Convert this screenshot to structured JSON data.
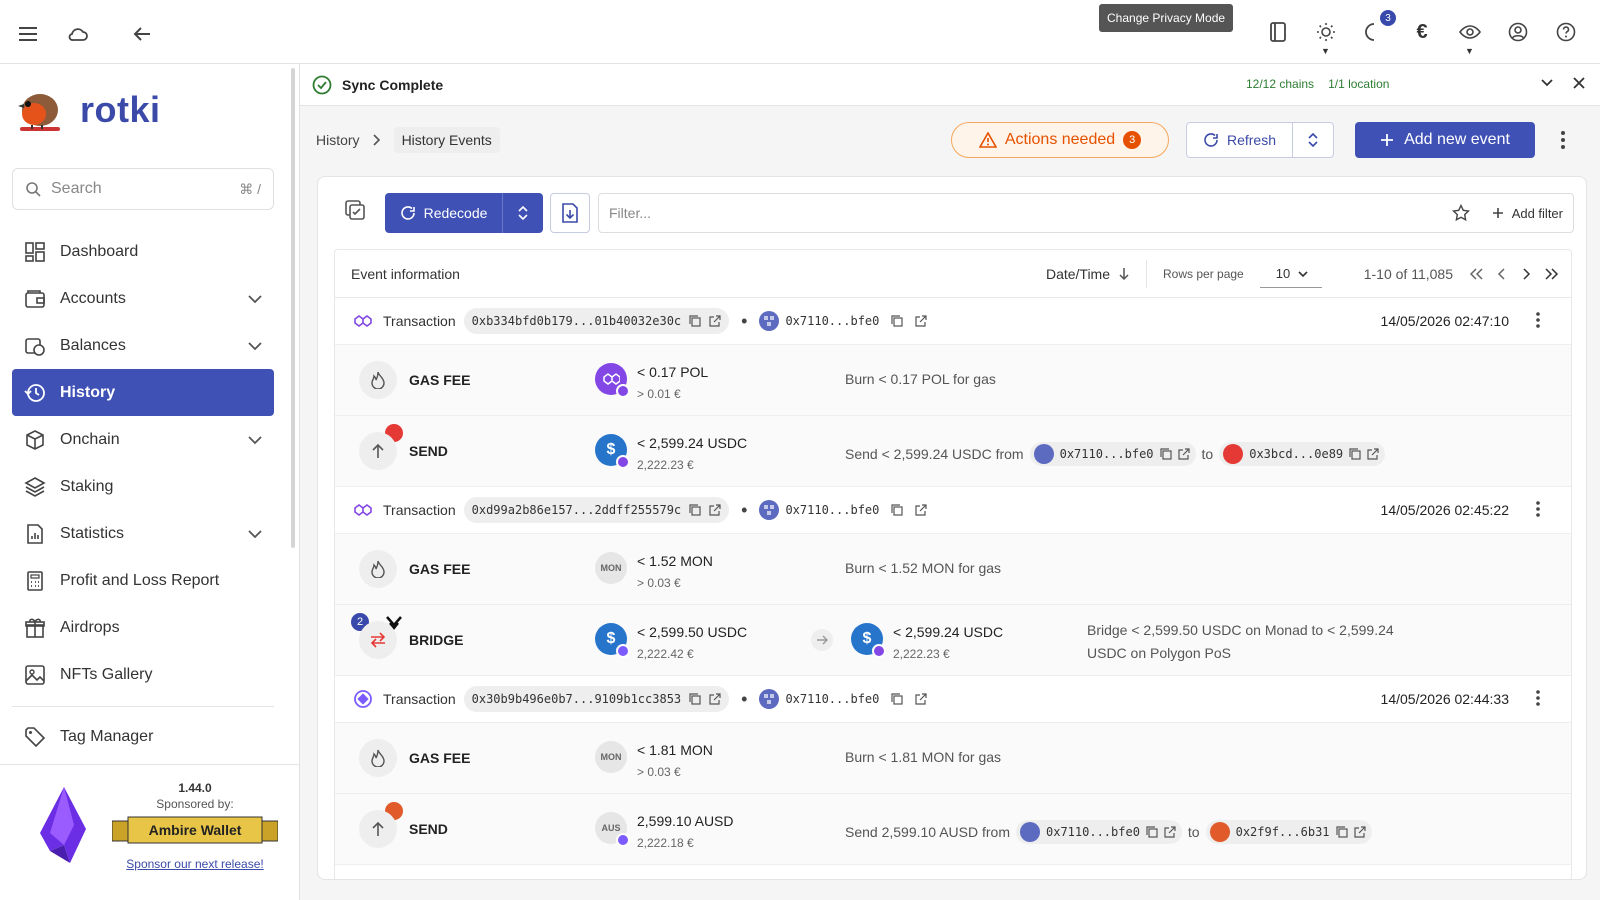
{
  "topbar": {
    "notification_count": "3",
    "currency_symbol": "€"
  },
  "sidebar": {
    "logo_text": "rotki",
    "search_placeholder": "Search",
    "search_shortcut": "⌘ /",
    "items": [
      {
        "label": "Dashboard",
        "icon": "dashboard-icon",
        "expandable": false,
        "active": false
      },
      {
        "label": "Accounts",
        "icon": "wallet-icon",
        "expandable": true,
        "active": false
      },
      {
        "label": "Balances",
        "icon": "balances-icon",
        "expandable": true,
        "active": false
      },
      {
        "label": "History",
        "icon": "history-icon",
        "expandable": false,
        "active": true
      },
      {
        "label": "Onchain",
        "icon": "cube-icon",
        "expandable": true,
        "active": false
      },
      {
        "label": "Staking",
        "icon": "layers-icon",
        "expandable": false,
        "active": false
      },
      {
        "label": "Statistics",
        "icon": "chart-file-icon",
        "expandable": true,
        "active": false
      },
      {
        "label": "Profit and Loss Report",
        "icon": "calculator-icon",
        "expandable": false,
        "active": false
      },
      {
        "label": "Airdrops",
        "icon": "gift-icon",
        "expandable": false,
        "active": false
      },
      {
        "label": "NFTs Gallery",
        "icon": "image-icon",
        "expandable": false,
        "active": false
      }
    ],
    "tag_manager": "Tag Manager",
    "sponsor": {
      "version": "1.44.0",
      "sponsored_by": "Sponsored by:",
      "sponsor_name": "Ambire Wallet",
      "link": "Sponsor our next release!"
    }
  },
  "sync": {
    "status": "Sync Complete",
    "chains": "12/12 chains",
    "location": "1/1 location",
    "tooltip": "Change Privacy Mode"
  },
  "header": {
    "breadcrumb_root": "History",
    "breadcrumb_current": "History Events",
    "actions_label": "Actions needed",
    "actions_count": "3",
    "refresh_label": "Refresh",
    "add_label": "Add new event"
  },
  "toolbar": {
    "redecode_label": "Redecode",
    "filter_placeholder": "Filter...",
    "add_filter": "Add filter"
  },
  "table": {
    "col_event": "Event information",
    "col_sort": "Date/Time",
    "rows_per_page_label": "Rows per page",
    "rows_per_page": "10",
    "range": "1-10 of 11,085",
    "groups": [
      {
        "label": "Transaction",
        "hash": "0xb334bfd0b179...01b40032e30c",
        "address": "0x7110...bfe0",
        "time": "14/05/2026 02:47:10",
        "events": [
          {
            "type": "GAS FEE",
            "icon": "flame-icon",
            "asset": "POL",
            "asset_color": "#8247e5",
            "amount": "< 0.17 POL",
            "value": "> 0.01 €",
            "desc": "Burn < 0.17 POL for gas"
          },
          {
            "type": "SEND",
            "icon": "arrow-up-icon",
            "asset": "USDC",
            "asset_color": "#2775ca",
            "amount": "< 2,599.24 USDC",
            "value": "2,222.23 €",
            "desc": "Send < 2,599.24 USDC from",
            "from": "0x7110...bfe0",
            "to_word": "to",
            "to": "0x3bcd...0e89"
          }
        ]
      },
      {
        "label": "Transaction",
        "hash": "0xd99a2b86e157...2ddff255579c",
        "address": "0x7110...bfe0",
        "time": "14/05/2026 02:45:22",
        "events": [
          {
            "type": "GAS FEE",
            "icon": "flame-icon",
            "asset": "MON",
            "asset_color": "#e0e0e0",
            "amount": "< 1.52 MON",
            "value": "> 0.03 €",
            "desc": "Burn < 1.52 MON for gas"
          },
          {
            "type": "BRIDGE",
            "icon": "swap-icon",
            "badge": "2",
            "asset": "USDC",
            "asset_color": "#2775ca",
            "amount": "< 2,599.50 USDC",
            "value": "2,222.42 €",
            "amount2": "< 2,599.24 USDC",
            "value2": "2,222.23 €",
            "desc_line1": "Bridge < 2,599.50 USDC on Monad to < 2,599.24",
            "desc_line2": "USDC on Polygon PoS"
          }
        ]
      },
      {
        "label": "Transaction",
        "hash": "0x30b9b496e0b7...9109b1cc3853",
        "address": "0x7110...bfe0",
        "time": "14/05/2026 02:44:33",
        "events": [
          {
            "type": "GAS FEE",
            "icon": "flame-icon",
            "asset": "MON",
            "asset_color": "#e0e0e0",
            "amount": "< 1.81 MON",
            "value": "> 0.03 €",
            "desc": "Burn < 1.81 MON for gas"
          },
          {
            "type": "SEND",
            "icon": "arrow-up-icon",
            "asset": "AUS",
            "asset_color": "#e0e0e0",
            "amount": "2,599.10 AUSD",
            "value": "2,222.18 €",
            "desc": "Send 2,599.10 AUSD from",
            "from": "0x7110...bfe0",
            "to_word": "to",
            "to": "0x2f9f...6b31"
          }
        ]
      }
    ]
  }
}
